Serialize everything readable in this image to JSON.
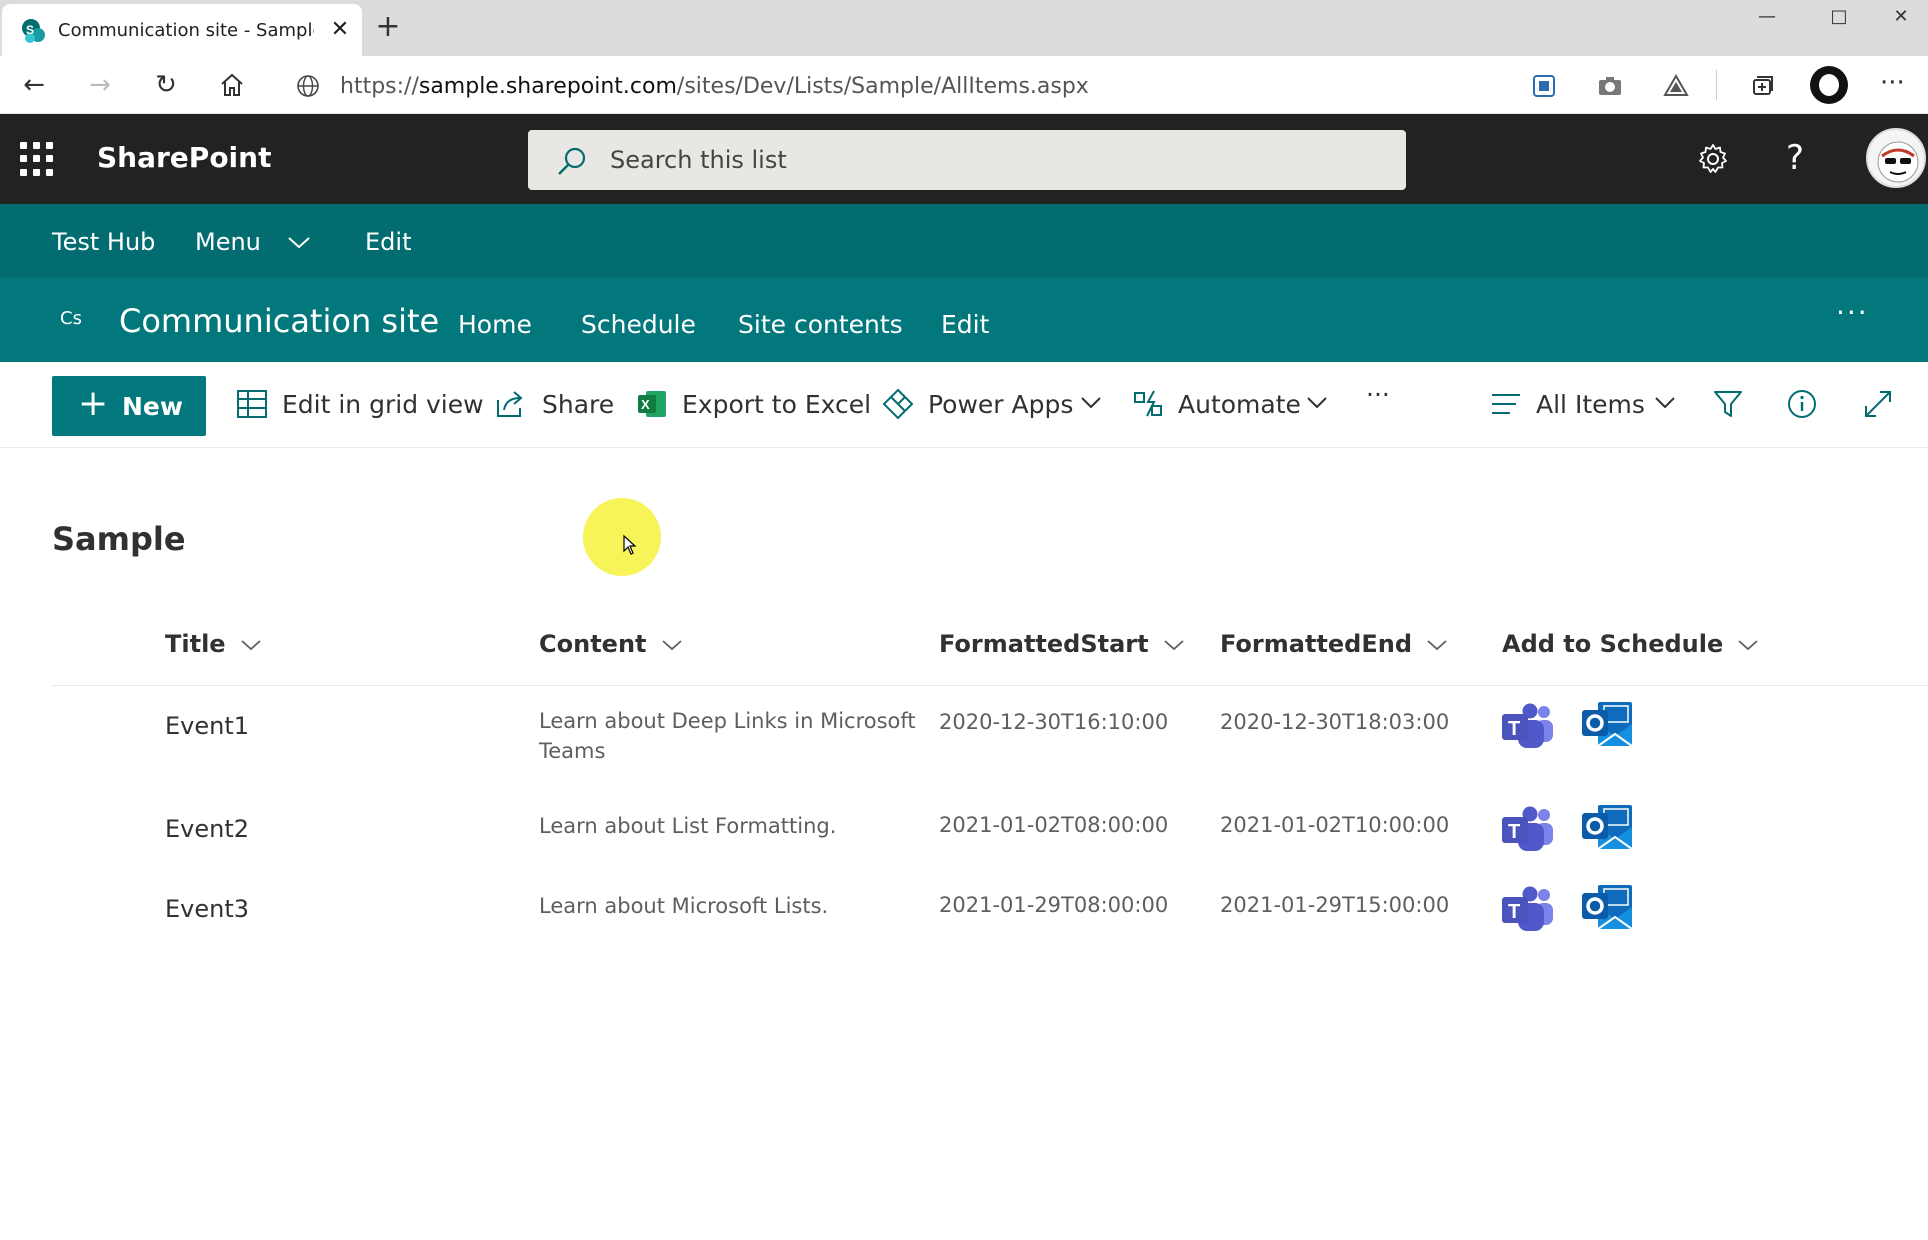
{
  "browser": {
    "tab_title": "Communication site - Sample - A",
    "url_prefix": "https://",
    "url_host": "sample.sharepoint.com",
    "url_path": "/sites/Dev/Lists/Sample/AllItems.aspx"
  },
  "suitebar": {
    "brand": "SharePoint",
    "search_placeholder": "Search this list",
    "help_label": "?"
  },
  "hubnav": {
    "items": [
      "Test Hub",
      "Menu",
      "Edit"
    ]
  },
  "site": {
    "logo_text": "Cs",
    "title": "Communication site",
    "nav": [
      "Home",
      "Schedule",
      "Site contents",
      "Edit"
    ],
    "more": "···"
  },
  "commandbar": {
    "new_label": "New",
    "edit_grid_label": "Edit in grid view",
    "share_label": "Share",
    "export_label": "Export to Excel",
    "powerapps_label": "Power Apps",
    "automate_label": "Automate",
    "more_label": "···",
    "view_label": "All Items"
  },
  "list": {
    "title": "Sample",
    "columns": [
      "Title",
      "Content",
      "FormattedStart",
      "FormattedEnd",
      "Add to Schedule"
    ],
    "rows": [
      {
        "title": "Event1",
        "content": "Learn about Deep Links in Microsoft Teams",
        "start": "2020-12-30T16:10:00",
        "end": "2020-12-30T18:03:00"
      },
      {
        "title": "Event2",
        "content": "Learn about List Formatting.",
        "start": "2021-01-02T08:00:00",
        "end": "2021-01-02T10:00:00"
      },
      {
        "title": "Event3",
        "content": "Learn about Microsoft Lists.",
        "start": "2021-01-29T08:00:00",
        "end": "2021-01-29T15:00:00"
      }
    ]
  },
  "colors": {
    "suitebar": "#222222",
    "hubnav": "#036c70",
    "site_header": "#03787c",
    "teams_purple": "#5558af",
    "outlook_blue": "#0f6cbd"
  }
}
